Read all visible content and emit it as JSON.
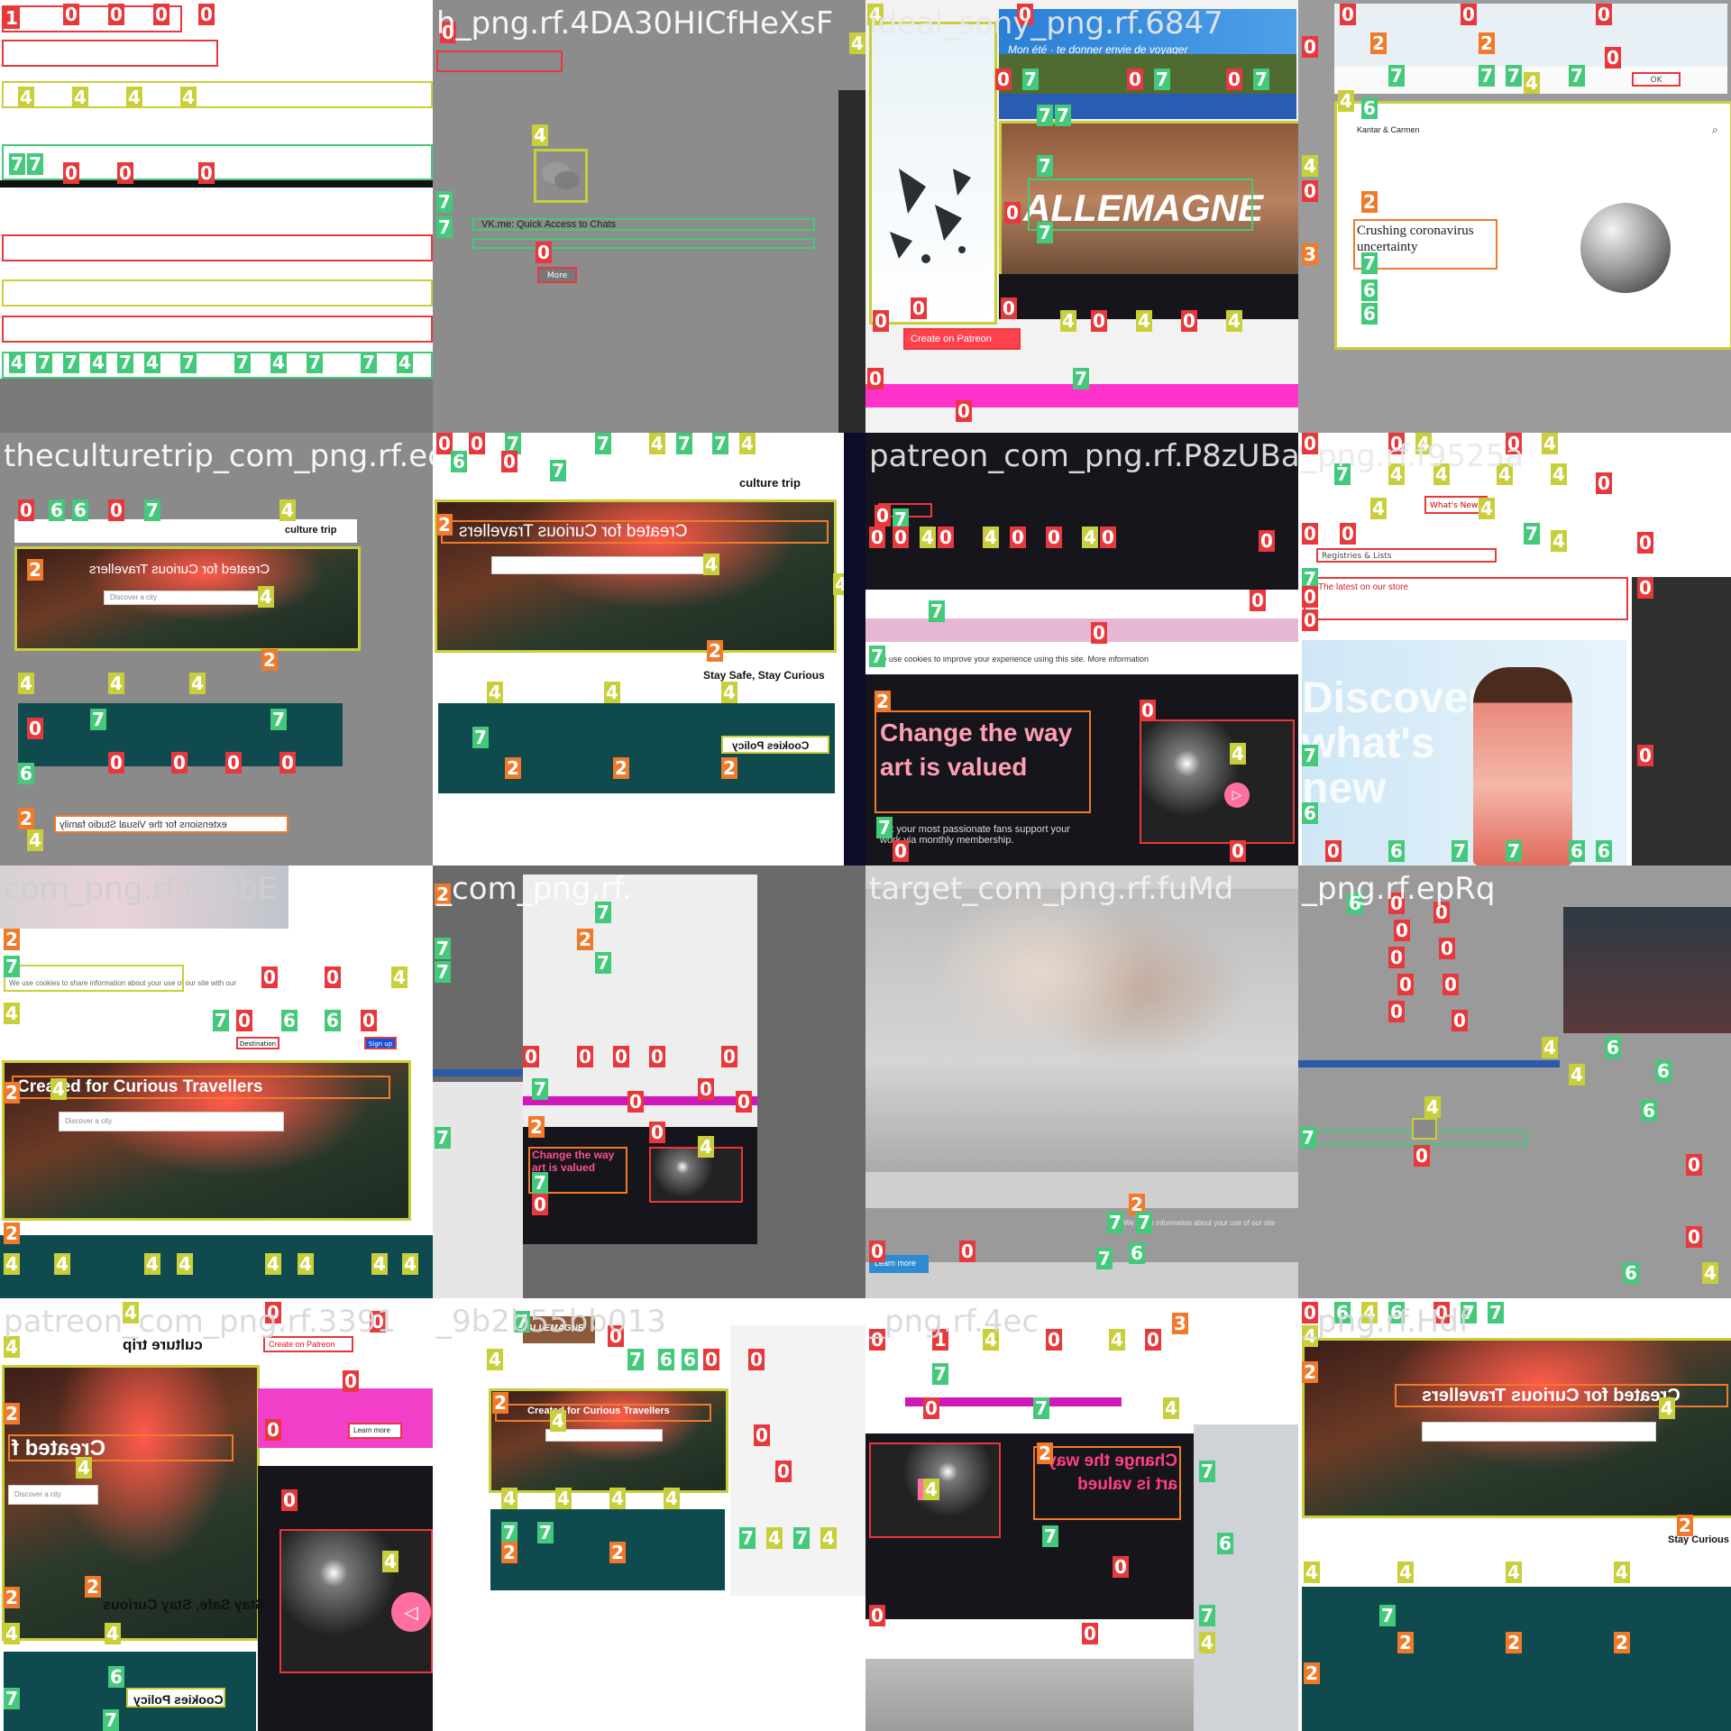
{
  "tiles": [
    {
      "caption": "",
      "heading": "",
      "sub": ""
    },
    {
      "caption": "h_png.rf.4DA30HICfHeXsF",
      "heading": "VK.me: Quick Access to Chats",
      "button": "More"
    },
    {
      "caption": "ideal_sony_png.rf.6847",
      "heading": "ALLEMAGNE",
      "banner": "Mon été · te donner envie de voyager",
      "button": "Create on Patreon"
    },
    {
      "caption": "",
      "heading": "Crushing coronavirus uncertainty",
      "brand": "Kantar & Carmen",
      "button": "OK"
    },
    {
      "caption": "theculturetrip_com_png.rf.ec",
      "heading": "Created for Curious Travellers",
      "brand": "culture trip",
      "search": "Discover a city",
      "sub": "extensions for the Visual Studio family"
    },
    {
      "caption": "",
      "heading": "Created for Curious Travellers",
      "sub": "Stay Safe, Stay Curious",
      "policy": "Cookies Policy",
      "brand": "culture trip"
    },
    {
      "caption": "patreon_com_png.rf.P8zUBa",
      "heading": "Change the way art is valued",
      "sub": "Let your most passionate fans support your work via monthly membership.",
      "notice": "We use cookies to improve your experience using this site. More information"
    },
    {
      "caption": "_png.rf.f9525a",
      "heading": "Discover what's new",
      "sub": "The latest on our store",
      "side": "Registries & Lists",
      "nav": "What's New"
    },
    {
      "caption": "com_png.rf.MJhbE",
      "heading": "Created for Curious Travellers",
      "search": "Discover a city",
      "notice": "We use cookies to share information about your use of our site with our",
      "buttons": [
        "Destination",
        "Sign up"
      ]
    },
    {
      "caption": "_com_png.rf.",
      "heading": "Change the way art is valued"
    },
    {
      "caption": "target_com_png.rf.fuMd",
      "notice": "We share information about your use of our site",
      "button": "Learn more"
    },
    {
      "caption": "_png.rf.epRq",
      "heading": ""
    },
    {
      "caption": "patreon_com_png.rf.3391",
      "heading": "Created f",
      "sub": "Stay Safe, Stay Curious",
      "policy": "Cookies Policy",
      "brand": "culture trip",
      "search": "Discover a city",
      "button": "Create on Patreon",
      "link": "Learn more"
    },
    {
      "caption": "_9b2b55bb013",
      "heading": "Created for Curious Travellers",
      "brand": "ALLEMAGNE"
    },
    {
      "caption": "_png.rf.4ec",
      "heading": "Change the way art is valued"
    },
    {
      "caption": "_png.rf.Hdf",
      "heading": "Created for Curious Travellers",
      "sub": "Stay Curious"
    }
  ]
}
